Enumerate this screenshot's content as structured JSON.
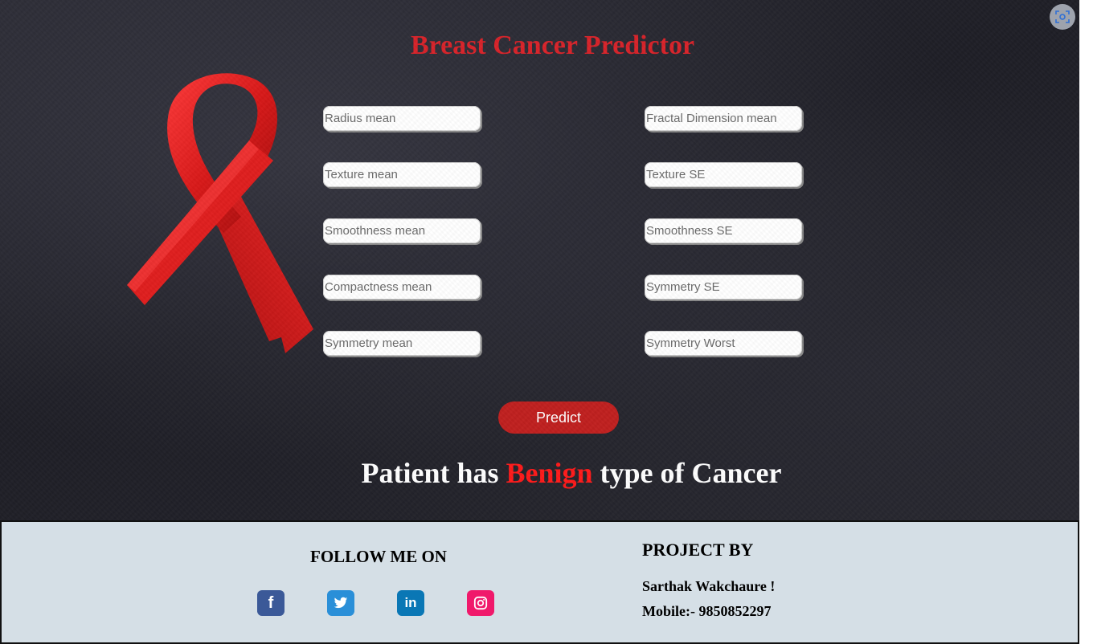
{
  "title": "Breast Cancer Predictor",
  "form": {
    "left_fields": [
      {
        "placeholder": "Radius mean"
      },
      {
        "placeholder": "Texture mean"
      },
      {
        "placeholder": "Smoothness mean"
      },
      {
        "placeholder": "Compactness mean"
      },
      {
        "placeholder": "Symmetry mean"
      }
    ],
    "right_fields": [
      {
        "placeholder": "Fractal Dimension mean"
      },
      {
        "placeholder": "Texture SE"
      },
      {
        "placeholder": "Smoothness SE"
      },
      {
        "placeholder": "Symmetry SE"
      },
      {
        "placeholder": "Symmetry Worst"
      }
    ],
    "predict_label": "Predict"
  },
  "result": {
    "prefix": "Patient has",
    "highlight": "Benign",
    "suffix": "type of Cancer"
  },
  "footer": {
    "follow_title": "FOLLOW ME ON",
    "social": [
      {
        "icon": "facebook-icon",
        "glyph": "f",
        "color": "#3b5998"
      },
      {
        "icon": "twitter-icon",
        "glyph": "",
        "color": "#2a8fd8"
      },
      {
        "icon": "linkedin-icon",
        "glyph": "in",
        "color": "#0a77b5"
      },
      {
        "icon": "instagram-icon",
        "glyph": "",
        "color": "#f0196b"
      }
    ],
    "project_title": "PROJECT BY",
    "author": "Sarthak Wakchaure !",
    "mobile": "Mobile:- 9850852297"
  },
  "colors": {
    "title_red": "#d8232a",
    "button_red": "#c0201f",
    "highlight_red": "#ff1a1a",
    "footer_bg": "#d5dfe6"
  }
}
